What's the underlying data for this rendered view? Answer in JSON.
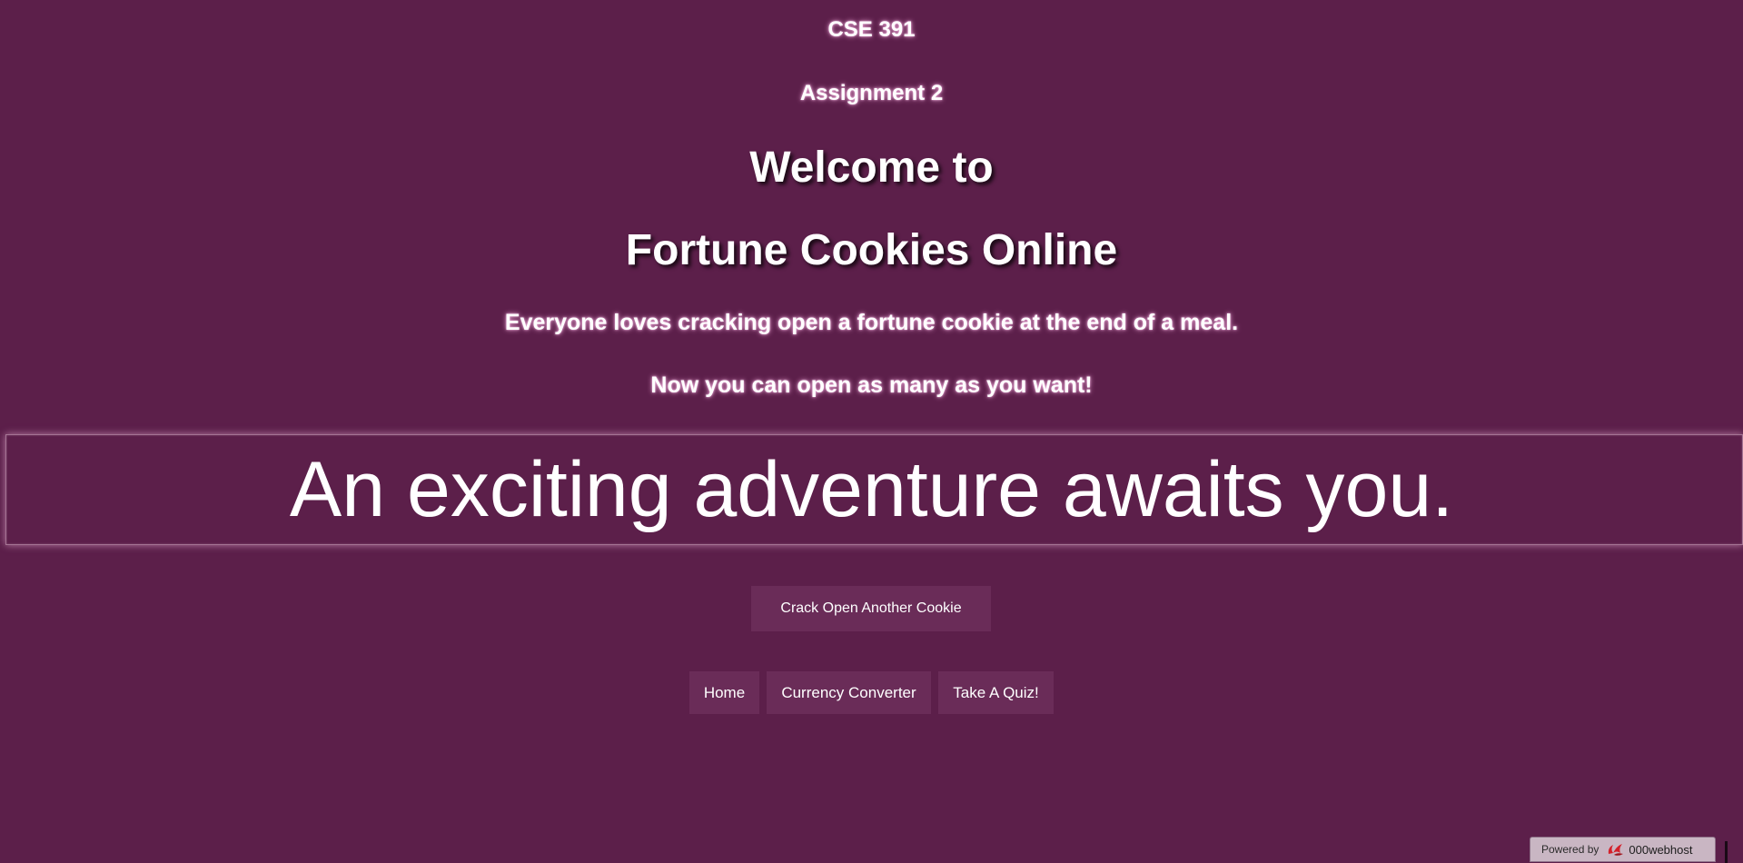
{
  "header": {
    "course": "CSE 391",
    "assignment": "Assignment 2",
    "welcome": "Welcome to",
    "site_name": "Fortune Cookies Online",
    "tagline_1": "Everyone loves cracking open a fortune cookie at the end of a meal.",
    "tagline_2": "Now you can open as many as you want!"
  },
  "fortune": {
    "text": "An exciting adventure awaits you."
  },
  "actions": {
    "crack_label": "Crack Open Another Cookie"
  },
  "nav": {
    "items": [
      {
        "label": "Home"
      },
      {
        "label": "Currency Converter"
      },
      {
        "label": "Take A Quiz!"
      }
    ]
  },
  "footer_badge": {
    "powered_by": "Powered by",
    "brand": "000webhost",
    "icon": "000webhost-logo-icon"
  },
  "colors": {
    "background": "#5c1f4a",
    "button": "#6a2c58",
    "text": "#ffffff",
    "badge": "#c9b6c3"
  }
}
